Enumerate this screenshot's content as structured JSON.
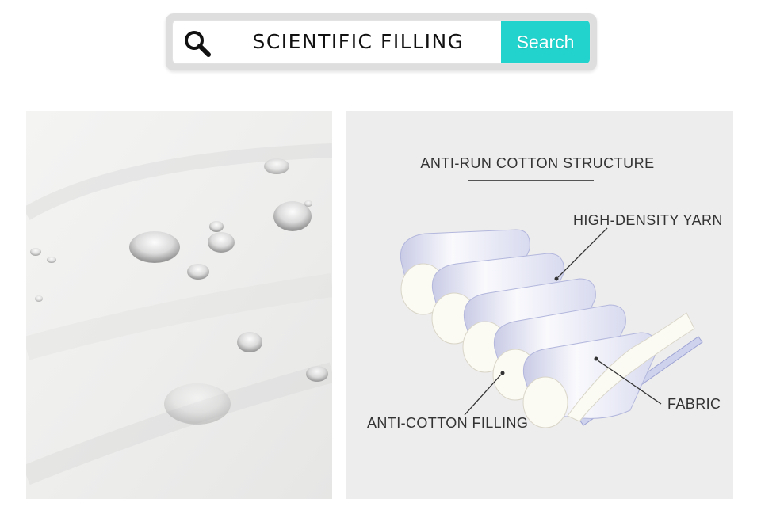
{
  "search": {
    "query": "SCIENTIFIC FILLING",
    "button_label": "Search",
    "icon": "search-icon",
    "accent_color": "#21d3cc"
  },
  "diagram": {
    "title": "ANTI-RUN COTTON STRUCTURE",
    "labels": {
      "yarn": "HIGH-DENSITY YARN",
      "filling": "ANTI-COTTON FILLING",
      "fabric": "FABRIC"
    }
  }
}
